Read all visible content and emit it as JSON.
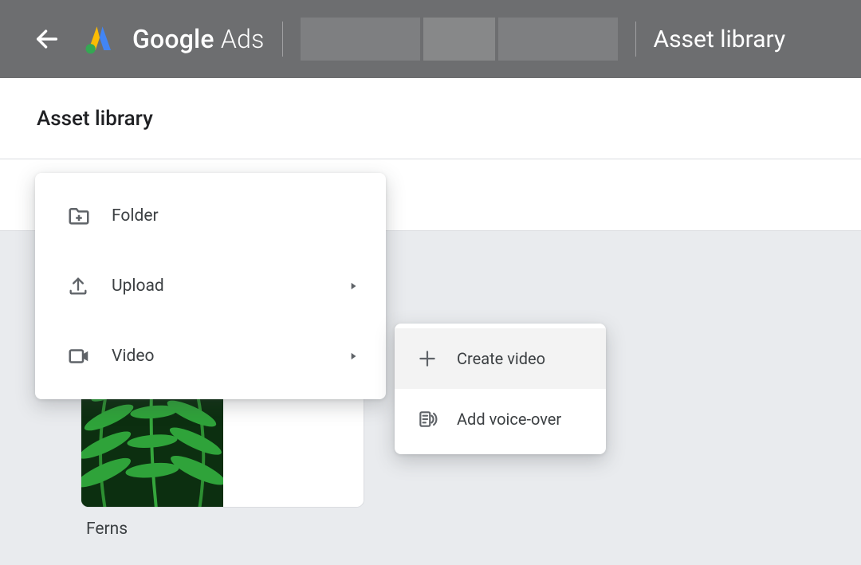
{
  "topbar": {
    "brand_google": "Google",
    "brand_ads": "Ads",
    "title": "Asset library"
  },
  "page": {
    "heading": "Asset library"
  },
  "asset": {
    "title": "Ferns"
  },
  "menu": {
    "items": [
      {
        "label": "Folder"
      },
      {
        "label": "Upload"
      },
      {
        "label": "Video"
      }
    ]
  },
  "submenu": {
    "items": [
      {
        "label": "Create video"
      },
      {
        "label": "Add voice-over"
      }
    ]
  }
}
